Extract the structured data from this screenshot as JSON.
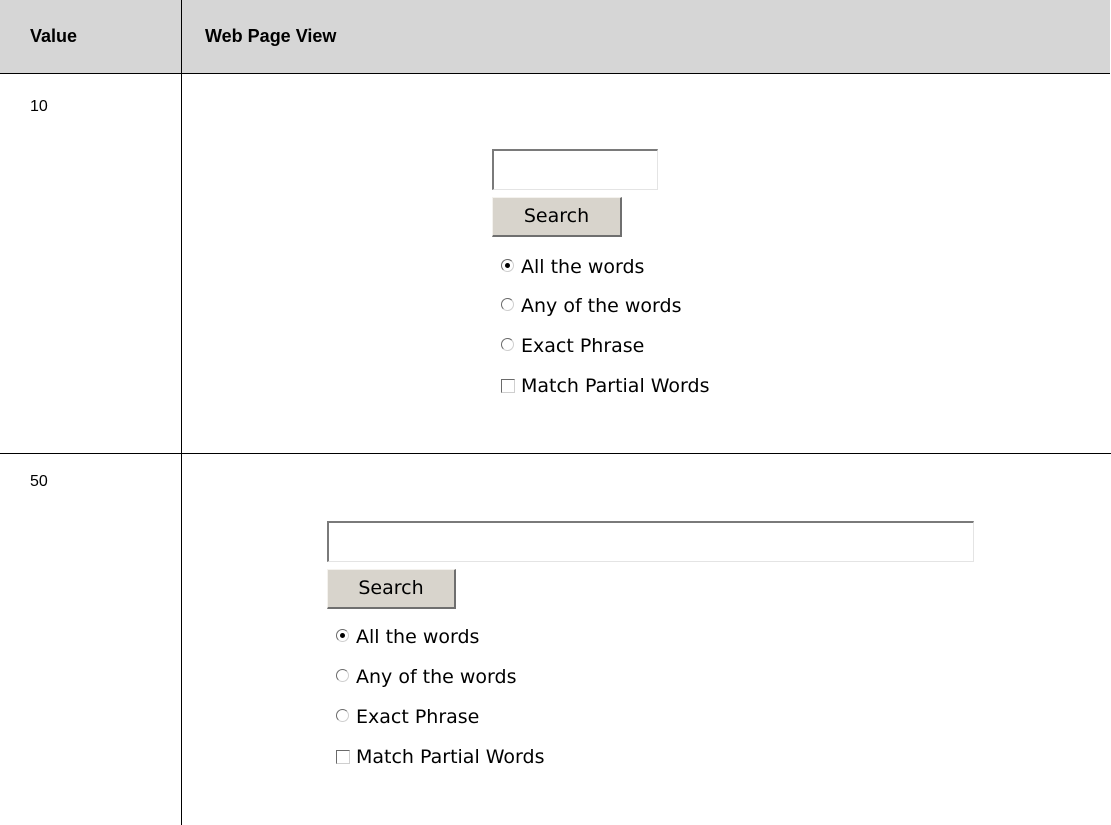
{
  "table": {
    "headers": [
      "Value",
      "Web Page View"
    ],
    "rows": [
      {
        "value": "10",
        "search_button": "Search",
        "options": {
          "all_words": "All the words",
          "any_words": "Any of the words",
          "exact_phrase": "Exact Phrase",
          "match_partial": "Match Partial Words"
        },
        "selected_option": "All the words",
        "match_partial_checked": false
      },
      {
        "value": "50",
        "search_button": "Search",
        "options": {
          "all_words": "All the words",
          "any_words": "Any of the words",
          "exact_phrase": "Exact Phrase",
          "match_partial": "Match Partial Words"
        },
        "selected_option": "All the words",
        "match_partial_checked": false
      }
    ]
  }
}
